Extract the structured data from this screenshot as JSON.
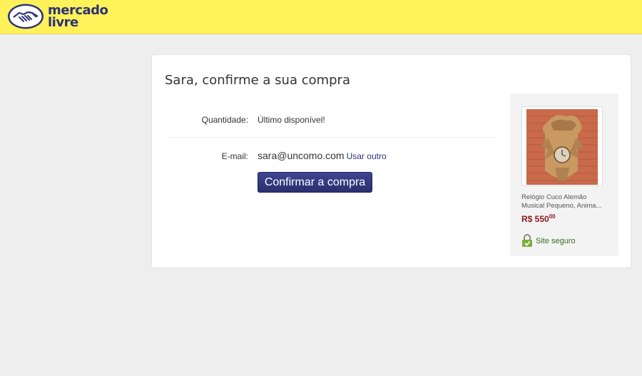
{
  "brand": {
    "line1": "mercado",
    "line2": "livre",
    "color": "#2d3277",
    "header_bg": "#fff159"
  },
  "checkout": {
    "title": "Sara, confirme a sua compra",
    "quantity_label": "Quantidade:",
    "quantity_value": "Último disponível!",
    "email_label": "E-mail:",
    "email_value": "sara@uncomo.com",
    "use_other": "Usar outro",
    "confirm_button": "Confirmar a compra"
  },
  "product": {
    "name": "Relógio Cuco Alemão Musical Pequeno, Anima...",
    "price_main": "R$ 550",
    "price_cents": "00",
    "price_color": "#8b1a1a",
    "secure_label": "Site seguro",
    "secure_icon": "lock-icon"
  }
}
